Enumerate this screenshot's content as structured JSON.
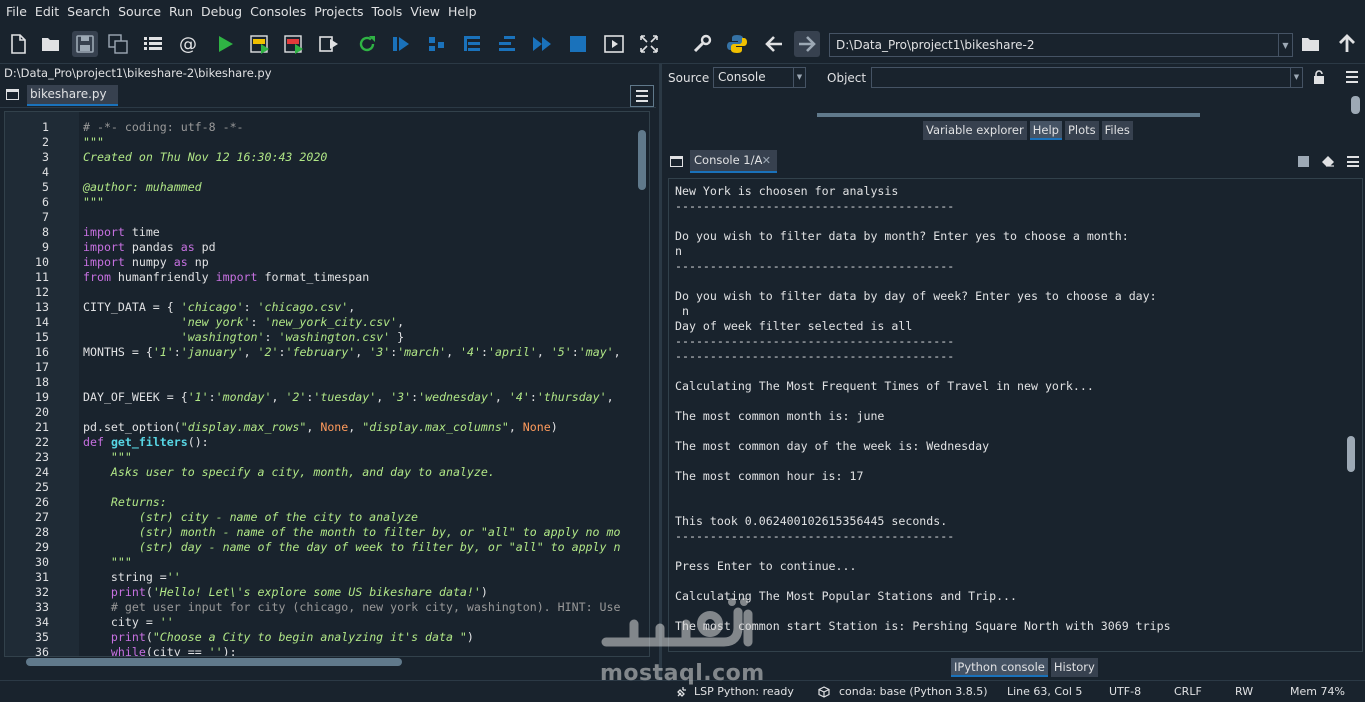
{
  "menu": [
    "File",
    "Edit",
    "Search",
    "Source",
    "Run",
    "Debug",
    "Consoles",
    "Projects",
    "Tools",
    "View",
    "Help"
  ],
  "toolbar": {
    "path_value": "D:\\Data_Pro\\project1\\bikeshare-2",
    "icons": [
      "new-file-icon",
      "open-folder-icon",
      "save-icon",
      "save-all-icon",
      "outline-icon",
      "at-icon",
      "run-icon",
      "run-cell-icon",
      "run-cell-advance-icon",
      "run-selection-icon",
      "rerun-icon",
      "debug-icon",
      "step-icon",
      "step-into-icon",
      "step-return-icon",
      "continue-icon",
      "stop-debug-icon",
      "maximize-pane-icon",
      "fullscreen-icon",
      "preferences-icon",
      "python-path-icon",
      "back-icon",
      "forward-icon",
      "browse-folder-icon",
      "parent-folder-icon"
    ]
  },
  "editor": {
    "file_path": "D:\\Data_Pro\\project1\\bikeshare-2\\bikeshare.py",
    "tab_label": "bikeshare.py"
  },
  "code": [
    {
      "n": "1",
      "t": "# -*- coding: utf-8 -*-"
    },
    {
      "n": "2",
      "t": "\"\"\""
    },
    {
      "n": "3",
      "t": "Created on Thu Nov 12 16:30:43 2020"
    },
    {
      "n": "4",
      "t": ""
    },
    {
      "n": "5",
      "t": "@author: muhammed"
    },
    {
      "n": "6",
      "t": "\"\"\""
    },
    {
      "n": "7",
      "t": ""
    },
    {
      "n": "8",
      "t": "import time"
    },
    {
      "n": "9",
      "t": "import pandas as pd"
    },
    {
      "n": "10",
      "t": "import numpy as np"
    },
    {
      "n": "11",
      "t": "from humanfriendly import format_timespan"
    },
    {
      "n": "12",
      "t": ""
    },
    {
      "n": "13",
      "t": "CITY_DATA = { 'chicago': 'chicago.csv',"
    },
    {
      "n": "14",
      "t": "              'new york': 'new_york_city.csv',"
    },
    {
      "n": "15",
      "t": "              'washington': 'washington.csv' }"
    },
    {
      "n": "16",
      "t": "MONTHS = {'1':'january', '2':'february', '3':'march', '4':'april', '5':'may',"
    },
    {
      "n": "17",
      "t": ""
    },
    {
      "n": "18",
      "t": ""
    },
    {
      "n": "19",
      "t": "DAY_OF_WEEK = {'1':'monday', '2':'tuesday', '3':'wednesday', '4':'thursday',"
    },
    {
      "n": "20",
      "t": ""
    },
    {
      "n": "21",
      "t": "pd.set_option(\"display.max_rows\", None, \"display.max_columns\", None)"
    },
    {
      "n": "22",
      "t": "def get_filters():"
    },
    {
      "n": "23",
      "t": "    \"\"\""
    },
    {
      "n": "24",
      "t": "    Asks user to specify a city, month, and day to analyze."
    },
    {
      "n": "25",
      "t": ""
    },
    {
      "n": "26",
      "t": "    Returns:"
    },
    {
      "n": "27",
      "t": "        (str) city - name of the city to analyze"
    },
    {
      "n": "28",
      "t": "        (str) month - name of the month to filter by, or \"all\" to apply no mo"
    },
    {
      "n": "29",
      "t": "        (str) day - name of the day of week to filter by, or \"all\" to apply n"
    },
    {
      "n": "30",
      "t": "    \"\"\""
    },
    {
      "n": "31",
      "t": "    string =''"
    },
    {
      "n": "32",
      "t": "    print('Hello! Let\\'s explore some US bikeshare data!')"
    },
    {
      "n": "33",
      "t": "    # get user input for city (chicago, new york city, washington). HINT: Use"
    },
    {
      "n": "34",
      "t": "    city = ''"
    },
    {
      "n": "35",
      "t": "    print(\"Choose a City to begin analyzing it's data \")"
    },
    {
      "n": "36",
      "t": "    while(city == ''):"
    }
  ],
  "help": {
    "source_label": "Source",
    "source_value": "Console",
    "object_label": "Object",
    "object_value": "",
    "tabs": [
      "Variable explorer",
      "Help",
      "Plots",
      "Files"
    ],
    "selected_tab": "Help"
  },
  "console": {
    "tab_label": "Console 1/A",
    "close_glyph": "✕",
    "lines": [
      "New York is choosen for analysis",
      "----------------------------------------",
      "",
      "Do you wish to filter data by month? Enter yes to choose a month:",
      "n",
      "----------------------------------------",
      "",
      "Do you wish to filter data by day of week? Enter yes to choose a day:",
      " n",
      "Day of week filter selected is all",
      "----------------------------------------",
      "----------------------------------------",
      "",
      "Calculating The Most Frequent Times of Travel in new york...",
      "",
      "The most common month is: june",
      "",
      "The most common day of the week is: Wednesday",
      "",
      "The most common hour is: 17",
      "",
      "",
      "This took 0.062400102615356445 seconds.",
      "----------------------------------------",
      "",
      "Press Enter to continue...",
      "",
      "Calculating The Most Popular Stations and Trip...",
      "",
      "The most common start Station is: Pershing Square North with 3069 trips"
    ],
    "bottom_tabs": [
      "IPython console",
      "History"
    ],
    "selected_bottom_tab": "IPython console"
  },
  "status": {
    "lsp": "LSP Python: ready",
    "conda": "conda: base (Python 3.8.5)",
    "position": "Line 63, Col 5",
    "encoding": "UTF-8",
    "eol": "CRLF",
    "permissions": "RW",
    "memory": "Mem 74%"
  },
  "watermark": {
    "arabic": "مستقل",
    "latin": "mostaql.com"
  },
  "colors": {
    "background": "#19232d",
    "accent": "#1a72bb",
    "keyword": "#c670e0",
    "string": "#b0e686",
    "function": "#57d6e4",
    "number": "#faed5c"
  }
}
